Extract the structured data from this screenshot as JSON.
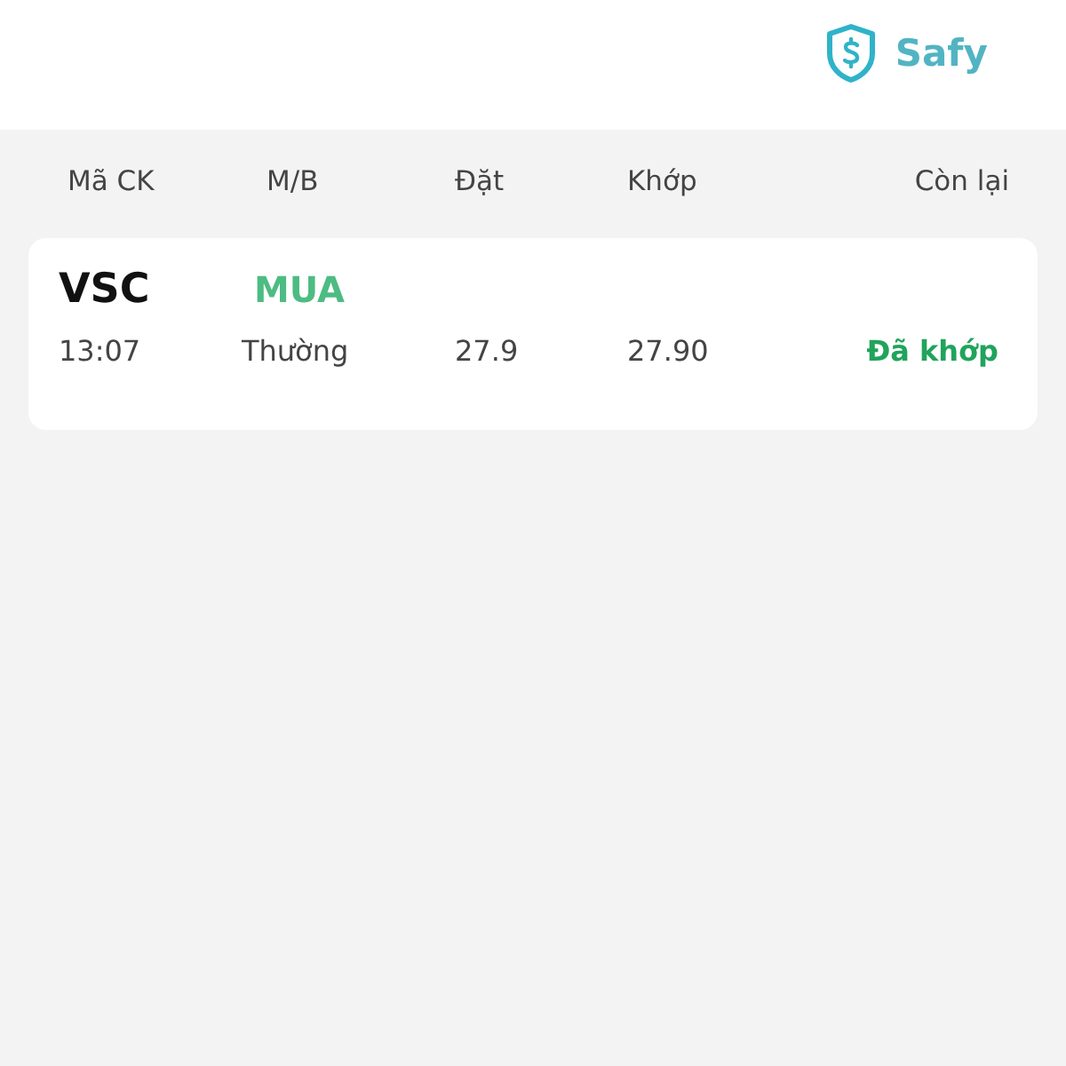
{
  "brand": {
    "name": "Safy"
  },
  "table": {
    "columns": [
      "Mã CK",
      "M/B",
      "Đặt",
      "Khớp",
      "Còn lại"
    ],
    "rows": [
      {
        "symbol": "VSC",
        "side": "MUA",
        "time": "13:07",
        "order_type": "Thường",
        "order_price": "27.9",
        "matched_price": "27.90",
        "status": "Đã khớp"
      }
    ]
  }
}
